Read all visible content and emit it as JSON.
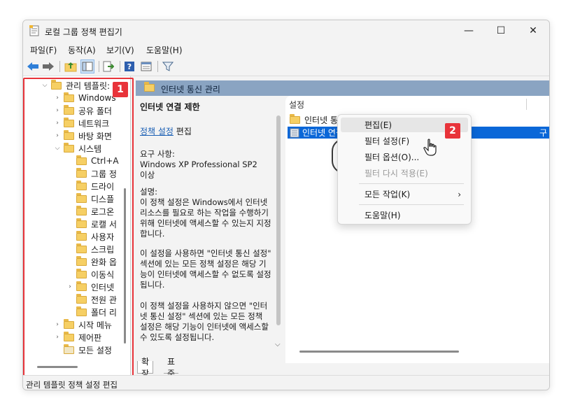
{
  "window": {
    "title": "로컬 그룹 정책 편집기",
    "minimize": "—",
    "maximize": "☐",
    "close": "✕"
  },
  "menu": [
    "파일(F)",
    "동작(A)",
    "보기(V)",
    "도움말(H)"
  ],
  "toolbar_icons": [
    "back-icon",
    "forward-icon",
    "up-folder-icon",
    "show-hide-tree-icon",
    "export-icon",
    "help-icon",
    "properties-icon",
    "filter-icon"
  ],
  "tree": {
    "items": [
      {
        "label": "관리 템플릿:",
        "expanded": true
      },
      {
        "label": "Windows",
        "expanded": false
      },
      {
        "label": "공유 폴더",
        "expanded": null
      },
      {
        "label": "네트워크",
        "expanded": false
      },
      {
        "label": "바탕 화면",
        "expanded": false
      },
      {
        "label": "시스템",
        "expanded": true
      },
      {
        "label": "Ctrl+A",
        "expanded": null
      },
      {
        "label": "그룹 정",
        "expanded": null
      },
      {
        "label": "드라이",
        "expanded": null
      },
      {
        "label": "디스플",
        "expanded": null
      },
      {
        "label": "로그온",
        "expanded": null
      },
      {
        "label": "로캘 서",
        "expanded": null
      },
      {
        "label": "사용자",
        "expanded": null
      },
      {
        "label": "스크립",
        "expanded": null
      },
      {
        "label": "완화 옵",
        "expanded": null
      },
      {
        "label": "이동식",
        "expanded": null
      },
      {
        "label": "인터넷",
        "expanded": false
      },
      {
        "label": "전원 관",
        "expanded": null
      },
      {
        "label": "폴더 리",
        "expanded": null
      },
      {
        "label": "시작 메뉴",
        "expanded": false
      },
      {
        "label": "제어판",
        "expanded": false
      },
      {
        "label": "모든 설정",
        "expanded": null
      }
    ],
    "badge": "1"
  },
  "content": {
    "header": "인터넷 통신 관리",
    "description": {
      "title": "인터넷 연결 제한",
      "link": "정책 설정",
      "link_suffix": " 편집",
      "requirements_label": "요구 사항:",
      "requirements": "Windows XP Professional SP2 이상",
      "desc_label": "설명:",
      "desc_p1": "이 정책 설정은 Windows에서 인터넷 리소스를 필요로 하는 작업을 수행하기 위해 인터넷에 액세스할 수 있는지 지정합니다.",
      "desc_p2": "이 설정을 사용하면 \"인터넷 통신 설정\" 섹션에 있는 모든 정책 설정은 해당 기능이 인터넷에 액세스할 수 없도록 설정됩니다.",
      "desc_p3": "이 정책 설정을 사용하지 않으면 \"인터넷 통신 설정\" 섹션에 있는 모든 정책 설정은 해당 기능이 인터넷에 액세스할 수 있도록 설정됩니다."
    },
    "list": {
      "column_header": "설정",
      "rows": [
        {
          "label": "인터넷 통신 설정",
          "state": "",
          "selected": false
        },
        {
          "label": "인터넷 연결 제한",
          "state": "구",
          "selected": true
        }
      ]
    },
    "tabs": [
      "확장",
      "표준"
    ],
    "badge": "2"
  },
  "context_menu": {
    "items": [
      {
        "label": "편집(E)",
        "disabled": false,
        "submenu": false
      },
      {
        "label": "필터 설정(F)",
        "disabled": false,
        "submenu": false
      },
      {
        "label": "필터 옵션(O)...",
        "disabled": false,
        "submenu": false
      },
      {
        "label": "필터 다시 적용(E)",
        "disabled": true,
        "submenu": false
      },
      {
        "label": "모든 작업(K)",
        "disabled": false,
        "submenu": true
      },
      {
        "label": "도움말(H)",
        "disabled": false,
        "submenu": false
      }
    ]
  },
  "status": "관리 템플릿 정책 설정 편집",
  "colors": {
    "highlight": "#e8333a",
    "selected_row": "#0a67d8",
    "header_band": "#8aa4c2"
  }
}
